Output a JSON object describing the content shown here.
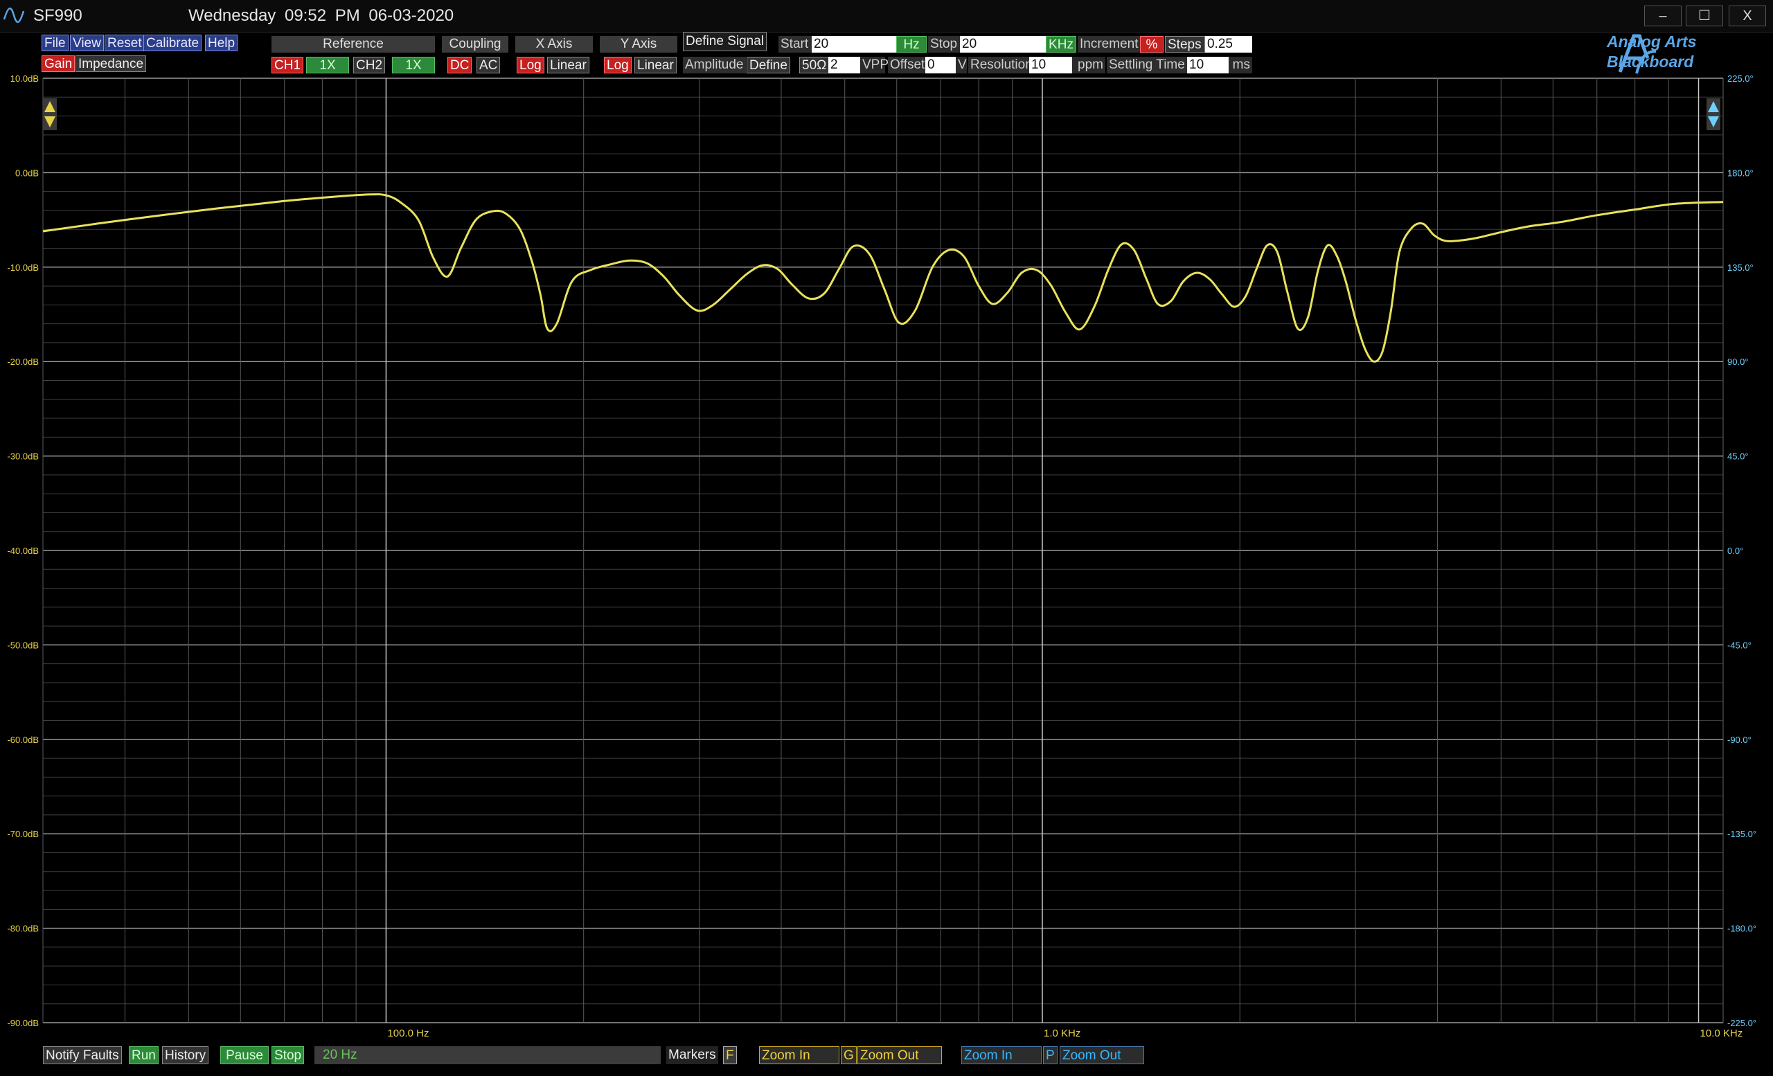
{
  "window": {
    "app_name": "SF990",
    "day": "Wednesday",
    "time": "09:52 PM",
    "date": "06-03-2020",
    "minimize": "–",
    "maximize": "☐",
    "close": "X"
  },
  "menu": [
    "File",
    "View",
    "Reset",
    "Calibrate",
    "Help"
  ],
  "mode": {
    "gain": "Gain",
    "impedance": "Impedance"
  },
  "toolbar": {
    "reference_header": "Reference",
    "coupling_header": "Coupling",
    "xaxis_header": "X Axis",
    "yaxis_header": "Y Axis",
    "define_signal": "Define Signal",
    "ch1": "CH1",
    "ch1_gain": "1X",
    "ch2": "CH2",
    "ch2_gain": "1X",
    "dc": "DC",
    "ac": "AC",
    "x_log": "Log",
    "x_linear": "Linear",
    "y_log": "Log",
    "y_linear": "Linear",
    "amplitude_label": "Amplitude",
    "define": "Define",
    "impedance_ohm": "50Ω",
    "amplitude_value": "2",
    "amplitude_unit": "VPP",
    "offset_label": "Offset",
    "offset_value": "0",
    "offset_unit": "V",
    "start_label": "Start",
    "start_value": "20",
    "start_unit": "Hz",
    "stop_label": "Stop",
    "stop_value": "20",
    "stop_unit": "KHz",
    "increment_label": "Increment",
    "increment_unit": "%",
    "steps_label": "Steps",
    "steps_value": "0.25",
    "resolution_label": "Resolution",
    "resolution_value": "10",
    "resolution_unit": "ppm",
    "settling_label": "Settling Time",
    "settling_value": "10",
    "settling_unit": "ms"
  },
  "brand": {
    "line1": "Analog Arts",
    "line2": "Blackboard"
  },
  "colors": {
    "background": "#000000",
    "grid": "#555555",
    "trace": "#e8e25a",
    "gain_axis": "#e8d24a",
    "phase_axis": "#6fd0ff"
  },
  "chart_data": {
    "type": "line",
    "x_scale": "log",
    "xlim": [
      30,
      10900
    ],
    "ylim": [
      -90,
      10
    ],
    "y2lim": [
      -225,
      225
    ],
    "grid": true,
    "x_tick_labels": [
      "100.0 Hz",
      "1.0 KHz",
      "10.0 KHz"
    ],
    "x_tick_values": [
      100,
      1000,
      10000
    ],
    "y_tick_labels": [
      "10.0dB",
      "0.0dB",
      "-10.0dB",
      "-20.0dB",
      "-30.0dB",
      "-40.0dB",
      "-50.0dB",
      "-60.0dB",
      "-70.0dB",
      "-80.0dB",
      "-90.0dB"
    ],
    "y2_tick_labels": [
      "225.0°",
      "180.0°",
      "135.0°",
      "90.0°",
      "45.0°",
      "0.0°",
      "-45.0°",
      "-90.0°",
      "-135.0°",
      "-180.0°",
      "-225.0°"
    ],
    "series": [
      {
        "x": [
          30,
          40,
          55,
          70,
          85,
          95,
          100,
          105,
          112,
          118,
          124,
          130,
          137,
          145,
          152,
          160,
          167,
          172,
          176,
          182,
          192,
          205,
          220,
          235,
          250,
          265,
          280,
          298,
          315,
          335,
          355,
          375,
          395,
          415,
          440,
          465,
          490,
          515,
          545,
          575,
          605,
          640,
          680,
          720,
          760,
          800,
          840,
          885,
          930,
          980,
          1030,
          1085,
          1140,
          1200,
          1260,
          1320,
          1380,
          1440,
          1500,
          1570,
          1640,
          1720,
          1800,
          1880,
          1960,
          2040,
          2120,
          2200,
          2280,
          2360,
          2450,
          2540,
          2630,
          2720,
          2810,
          2900,
          3000,
          3100,
          3200,
          3300,
          3400,
          3500,
          3650,
          3800,
          3950,
          4100,
          4300,
          4600,
          5000,
          5500,
          6200,
          7000,
          8000,
          9200,
          10900
        ],
        "y": [
          -6.2,
          -5,
          -3.8,
          -3,
          -2.5,
          -2.3,
          -2.4,
          -3.1,
          -5,
          -9,
          -11,
          -8,
          -5,
          -4.1,
          -4.3,
          -6,
          -9.5,
          -13,
          -16.5,
          -16,
          -11.5,
          -10.3,
          -9.7,
          -9.3,
          -9.6,
          -11,
          -13,
          -14.6,
          -14,
          -12.3,
          -10.7,
          -9.8,
          -10.2,
          -11.8,
          -13.3,
          -12.8,
          -10.2,
          -7.8,
          -8.6,
          -12.4,
          -15.9,
          -14.6,
          -10,
          -8.2,
          -8.9,
          -12,
          -13.9,
          -12.7,
          -10.6,
          -10.3,
          -11.9,
          -14.8,
          -16.6,
          -14.2,
          -10.3,
          -7.6,
          -8.2,
          -11.2,
          -13.9,
          -13.6,
          -11.5,
          -10.6,
          -11.3,
          -12.9,
          -14.2,
          -13.1,
          -10.2,
          -7.7,
          -8.4,
          -12.5,
          -16.5,
          -15.3,
          -10.4,
          -7.7,
          -8.8,
          -11.5,
          -15.5,
          -18.6,
          -20,
          -18.9,
          -14.5,
          -8.4,
          -5.9,
          -5.4,
          -6.6,
          -7.2,
          -7.2,
          -6.9,
          -6.3,
          -5.7,
          -5.2,
          -4.5,
          -3.9,
          -3.3,
          -3.1
        ]
      }
    ]
  },
  "bottom": {
    "notify_faults": "Notify Faults",
    "run": "Run",
    "history": "History",
    "pause": "Pause",
    "stop": "Stop",
    "status": "20 Hz",
    "markers": "Markers",
    "markers_key": "F",
    "zoom_in_g": "Zoom In",
    "g_key": "G",
    "zoom_out_g": "Zoom Out",
    "zoom_in_p": "Zoom In",
    "p_key": "P",
    "zoom_out_p": "Zoom Out"
  }
}
